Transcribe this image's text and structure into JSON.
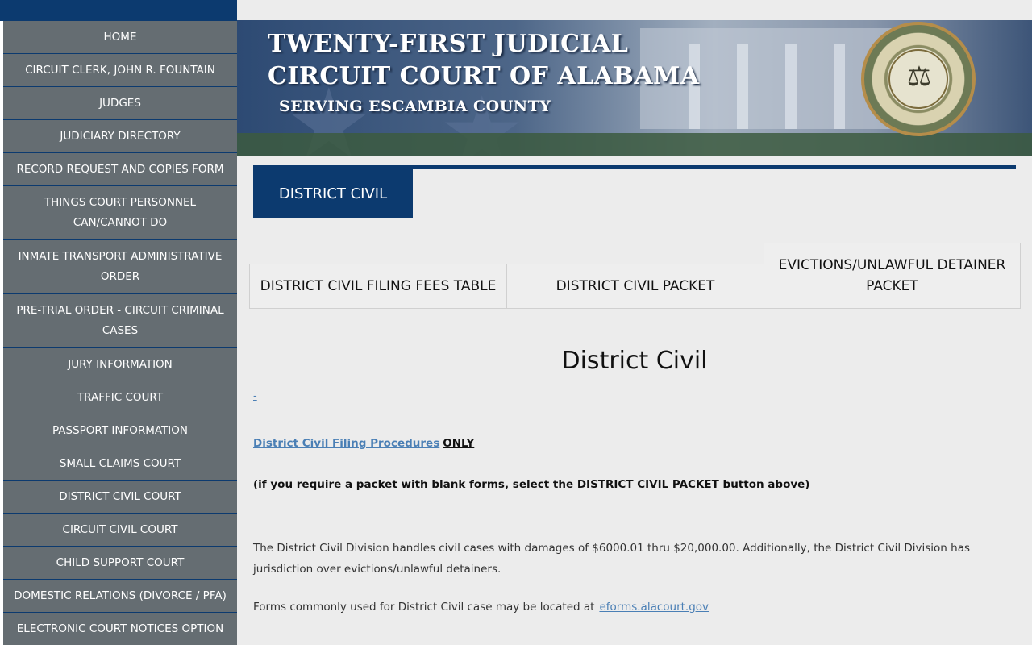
{
  "sidebar": {
    "items": [
      {
        "label": "HOME"
      },
      {
        "label": "CIRCUIT CLERK, JOHN R. FOUNTAIN"
      },
      {
        "label": "JUDGES"
      },
      {
        "label": "JUDICIARY DIRECTORY"
      },
      {
        "label": "RECORD REQUEST AND COPIES FORM"
      },
      {
        "label": "THINGS COURT PERSONNEL CAN/CANNOT DO"
      },
      {
        "label": "INMATE TRANSPORT ADMINISTRATIVE ORDER"
      },
      {
        "label": "PRE-TRIAL ORDER - CIRCUIT CRIMINAL CASES"
      },
      {
        "label": "JURY INFORMATION"
      },
      {
        "label": "TRAFFIC COURT"
      },
      {
        "label": "PASSPORT INFORMATION"
      },
      {
        "label": "SMALL CLAIMS COURT"
      },
      {
        "label": "DISTRICT CIVIL COURT"
      },
      {
        "label": "CIRCUIT CIVIL COURT"
      },
      {
        "label": "CHILD SUPPORT COURT"
      },
      {
        "label": "DOMESTIC RELATIONS (DIVORCE / PFA)"
      },
      {
        "label": "ELECTRONIC COURT NOTICES OPTION"
      }
    ]
  },
  "banner": {
    "line1": "TWENTY-FIRST JUDICIAL",
    "line2": "CIRCUIT COURT OF ALABAMA",
    "line3": "SERVING ESCAMBIA COUNTY"
  },
  "section": {
    "tab_label": "DISTRICT CIVIL"
  },
  "buttons": {
    "fees": "DISTRICT CIVIL FILING FEES TABLE",
    "packet": "DISTRICT CIVIL PACKET",
    "evictions": "EVICTIONS/UNLAWFUL DETAINER PACKET"
  },
  "content": {
    "title": "District Civil",
    "dash_link": "-",
    "procedures_link": "District Civil Filing Procedures",
    "procedures_only": "ONLY",
    "packet_note": "(if you require a packet with blank forms, select the DISTRICT CIVIL PACKET button above)",
    "description": "The District Civil Division handles civil cases with damages of $6000.01 thru $20,000.00. Additionally, the District Civil Division has jurisdiction over evictions/unlawful detainers.",
    "forms_text": "Forms commonly used for District Civil case may be located at",
    "forms_link": "eforms.alacourt.gov"
  },
  "colors": {
    "navy": "#0c3a6f",
    "sidebar_gray": "#656d72",
    "link_blue": "#4a7fb5"
  }
}
